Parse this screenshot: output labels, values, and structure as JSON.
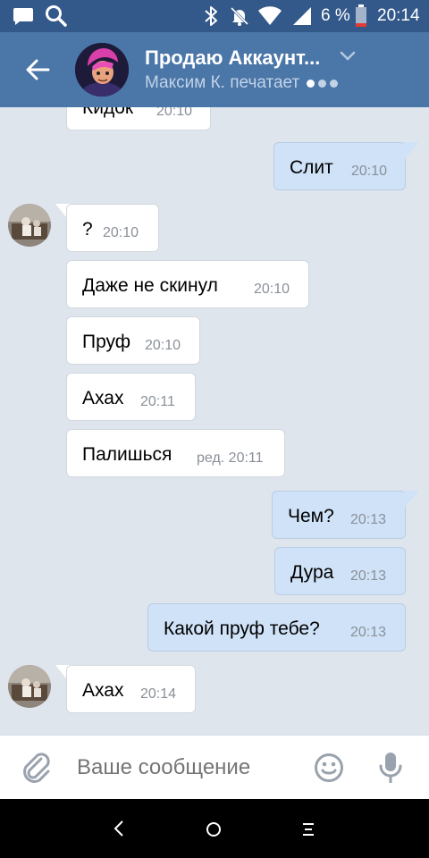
{
  "status_bar": {
    "battery_percent": "6 %",
    "time": "20:14"
  },
  "header": {
    "back_icon": "arrow-left-icon",
    "title": "Продаю Аккаунт...",
    "subtitle": "Максим К. печатает",
    "dropdown_icon": "chevron-down-icon"
  },
  "messages": [
    {
      "direction": "in",
      "text": "Кидок",
      "time": "20:10"
    },
    {
      "direction": "out",
      "text": "Слит",
      "time": "20:10"
    },
    {
      "direction": "in",
      "text": "?",
      "time": "20:10",
      "avatar": true
    },
    {
      "direction": "in",
      "text": "Даже не скинул",
      "time": "20:10"
    },
    {
      "direction": "in",
      "text": "Пруф",
      "time": "20:10"
    },
    {
      "direction": "in",
      "text": "Ахах",
      "time": "20:11"
    },
    {
      "direction": "in",
      "text": "Палишься",
      "time": "ред. 20:11"
    },
    {
      "direction": "out",
      "text": "Чем?",
      "time": "20:13"
    },
    {
      "direction": "out",
      "text": "Дура",
      "time": "20:13"
    },
    {
      "direction": "out",
      "text": "Какой пруф тебе?",
      "time": "20:13"
    },
    {
      "direction": "in",
      "text": "Ахах",
      "time": "20:14",
      "avatar": true
    }
  ],
  "composer": {
    "placeholder": "Ваше сообщение",
    "attach_icon": "paperclip-icon",
    "emoji_icon": "smile-icon",
    "mic_icon": "microphone-icon"
  },
  "colors": {
    "status_bar": "#33598a",
    "header": "#4a76a8",
    "chat_background": "#dfe5ec",
    "incoming_bubble": "#ffffff",
    "outgoing_bubble": "#cfe2f7",
    "time_text": "#8a9099"
  }
}
